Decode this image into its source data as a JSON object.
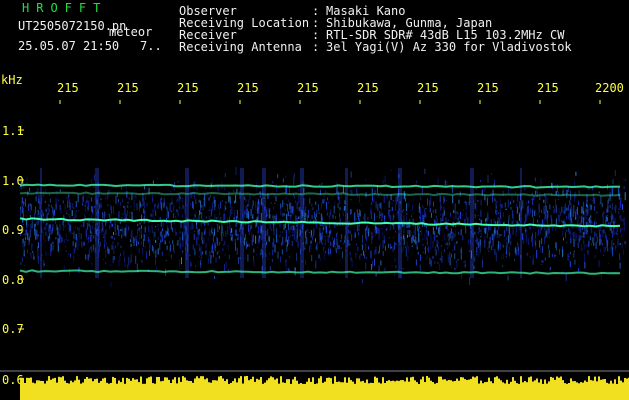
{
  "header": {
    "logo": "HROFFT",
    "filename": "UT2505072150.pn",
    "tag": "meteor",
    "datetime": "25.05.07 21:50",
    "count": "7..",
    "info": [
      {
        "label": "Observer",
        "value": "Masaki Kano"
      },
      {
        "label": "Receiving Location",
        "value": "Shibukawa, Gunma, Japan"
      },
      {
        "label": "Receiver",
        "value": "RTL-SDR SDR# 43dB L15 103.2MHz CW"
      },
      {
        "label": "Receiving Antenna",
        "value": "3el Yagi(V) Az 330 for Vladivostok"
      }
    ],
    "separator": ":"
  },
  "axes": {
    "y_unit": "kHz",
    "y_ticks": [
      "1.1",
      "1.0",
      "0.9",
      "0.8",
      "0.7",
      "0.6"
    ],
    "x_ticks": [
      "215",
      "215",
      "215",
      "215",
      "215",
      "215",
      "215",
      "215",
      "215",
      "2200"
    ]
  },
  "colors": {
    "text_green": "#20e040",
    "text_white": "#f0f0f0",
    "axis_yellow": "#ffff40",
    "background": "#000000",
    "spectrum_noise": "#1428b4",
    "spectrum_line": "#40ffb0",
    "bottom_bar": "#f0e020"
  }
}
